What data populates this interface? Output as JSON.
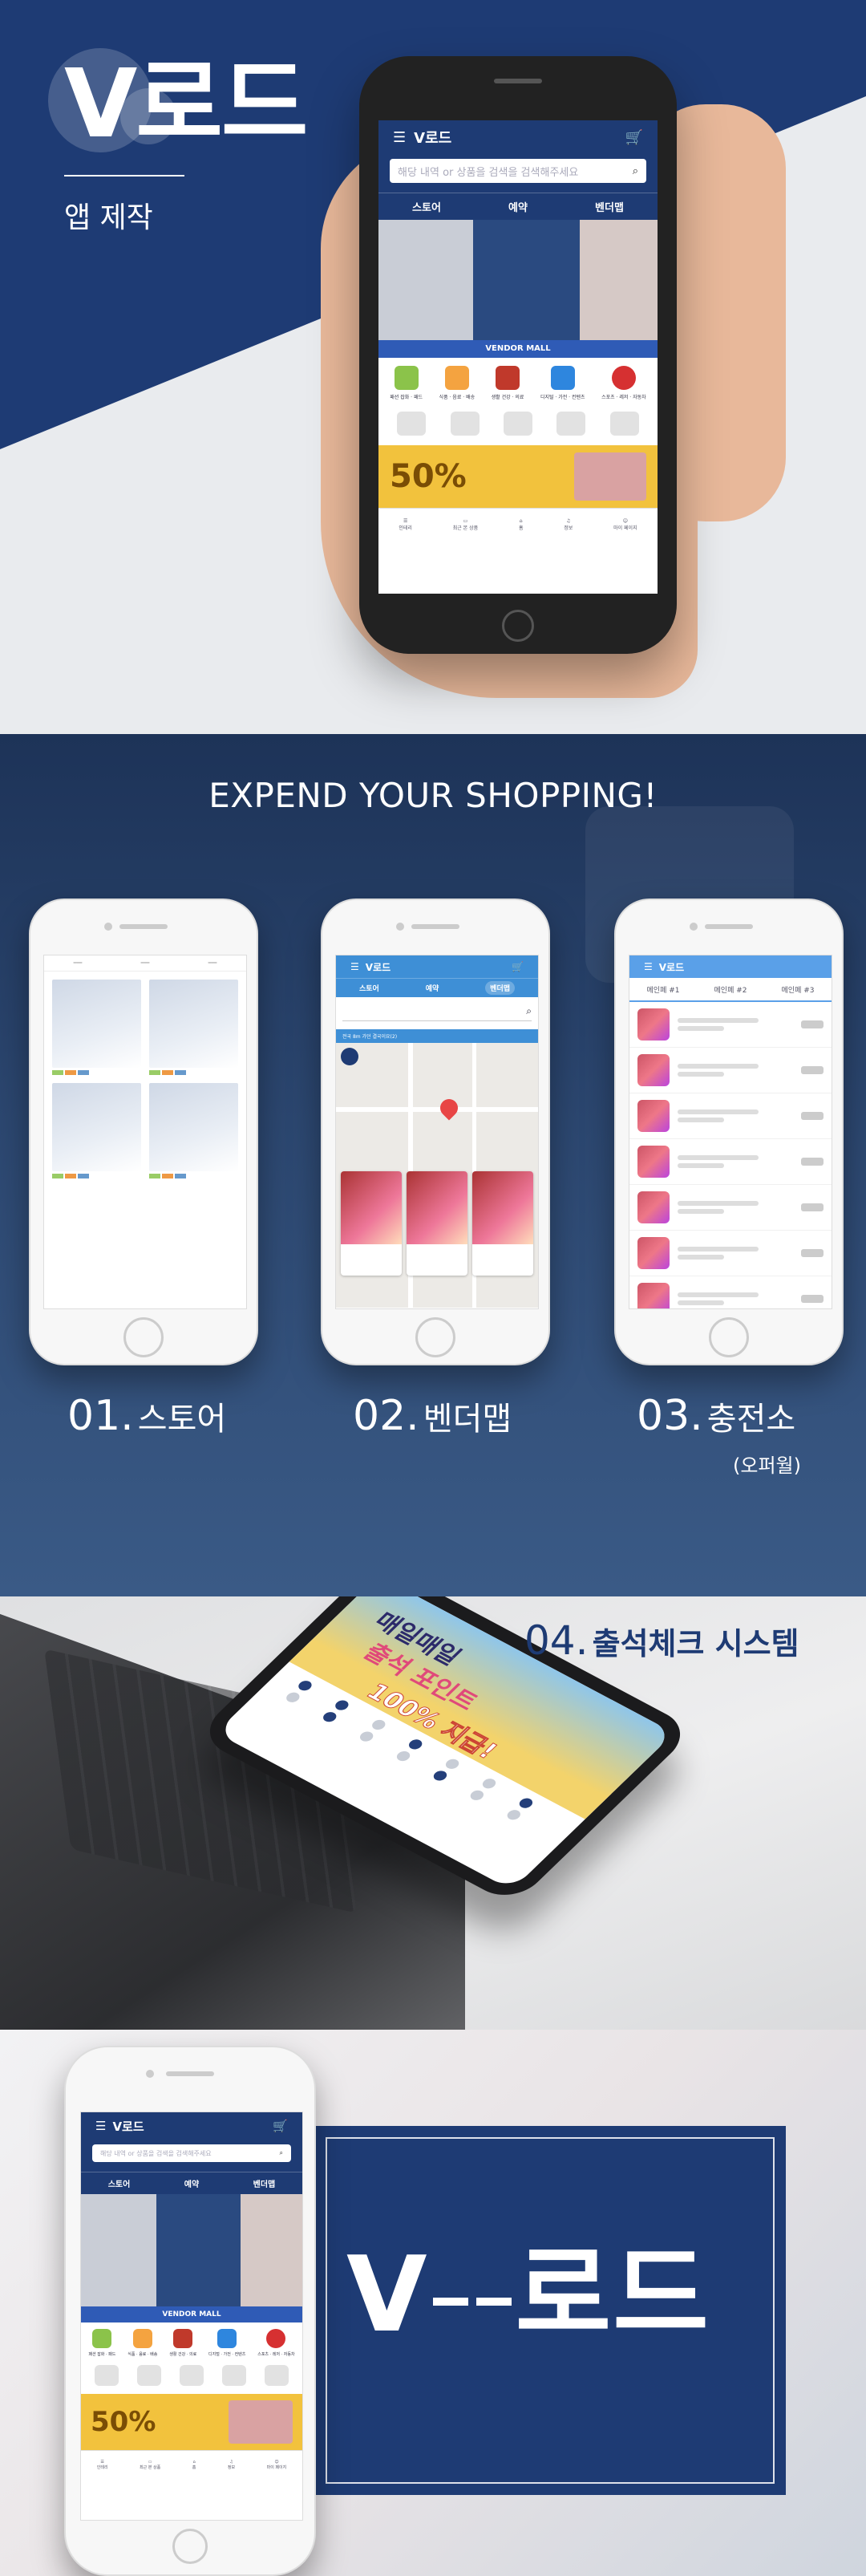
{
  "hero": {
    "title": "V로드",
    "subtitle": "앱 제작",
    "colors": {
      "navy": "#1e3b74",
      "bg": "#e9ebee"
    }
  },
  "app": {
    "logo": "V로드",
    "search_placeholder": "해당 내역 or 상품을 검색을 검색해주세요",
    "tabs": [
      "스토어",
      "예약",
      "벤더맵"
    ],
    "vendor_mall": "VENDOR MALL",
    "categories": [
      "패션 잡화 · 패드",
      "식품 · 음료 · 배송",
      "생활 건강 · 의료",
      "디지털 · 가전 · 컨텐츠",
      "스포츠 · 레저 · 자동차"
    ],
    "promo": "50%",
    "bottom_nav": [
      "인테리",
      "최근 본 상품",
      "홈",
      "정보",
      "마이 페이지"
    ]
  },
  "features": {
    "heading": "EXPEND YOUR SHOPPING!",
    "items": [
      {
        "num": "01.",
        "label": "스토어",
        "sub": ""
      },
      {
        "num": "02.",
        "label": "벤더맵",
        "sub": ""
      },
      {
        "num": "03.",
        "label": "충전소",
        "sub": "(오퍼월)"
      }
    ],
    "charge_tabs": [
      "메인페 #1",
      "메인페 #2",
      "메인페 #3"
    ],
    "map_address": "전국 8m 가던 결국이요(2)"
  },
  "attendance": {
    "num": "04.",
    "label": "출석체크 시스템",
    "screen_line1": "매일매일",
    "screen_line2": "출석 포인트",
    "screen_line3": "100% 지급!"
  },
  "brand": {
    "wordmark_v": "V",
    "wordmark_end": "로드"
  }
}
